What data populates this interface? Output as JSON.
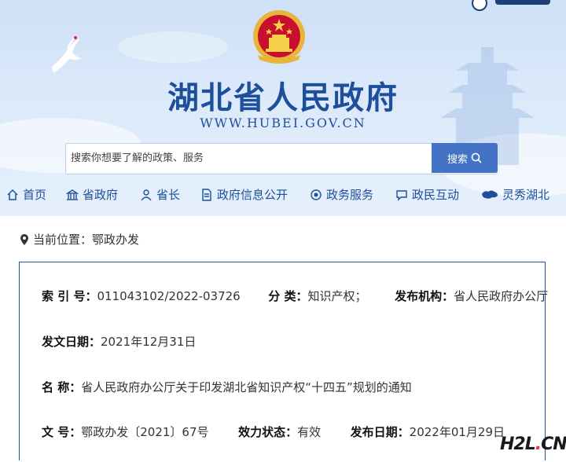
{
  "header": {
    "title": "湖北省人民政府",
    "url": "WWW.HUBEI.GOV.CN"
  },
  "search": {
    "placeholder": "搜索你想要了解的政策、服务",
    "button_label": "搜索"
  },
  "nav": {
    "items": [
      {
        "label": "首页",
        "icon": "home-icon"
      },
      {
        "label": "省政府",
        "icon": "building-icon"
      },
      {
        "label": "省长",
        "icon": "person-icon"
      },
      {
        "label": "政府信息公开",
        "icon": "document-icon"
      },
      {
        "label": "政务服务",
        "icon": "service-icon"
      },
      {
        "label": "政民互动",
        "icon": "chat-icon"
      },
      {
        "label": "灵秀湖北",
        "icon": "map-icon"
      }
    ]
  },
  "location": {
    "prefix": "当前位置：",
    "value": "鄂政办发"
  },
  "meta": {
    "index_label": "索 引 号：",
    "index_value": "011043102/2022-03726",
    "category_label": "分 类：",
    "category_value": "知识产权；",
    "issuer_label": "发布机构：",
    "issuer_value": "省人民政府办公厅",
    "issue_date_label": "发文日期：",
    "issue_date_value": "2021年12月31日",
    "name_label": "名 称：",
    "name_value": "省人民政府办公厅关于印发湖北省知识产权“十四五”规划的通知",
    "doc_no_label": "文 号：",
    "doc_no_value": "鄂政办发〔2021〕67号",
    "status_label": "效力状态：",
    "status_value": "有效",
    "publish_date_label": "发布日期：",
    "publish_date_value": "2022年01月29日"
  },
  "watermark": {
    "brand": "H2L",
    "dot": ".",
    "tld": "CN"
  },
  "colors": {
    "brand_blue": "#1d4f9c",
    "search_button": "#4472c4",
    "box_border": "#1d5aa8",
    "watermark_dot": "#e8313a"
  }
}
